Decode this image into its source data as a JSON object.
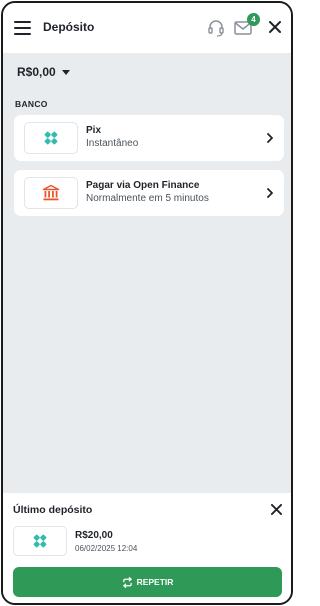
{
  "header": {
    "title": "Depósito",
    "mail_badge": "4"
  },
  "balance": {
    "amount": "R$0,00"
  },
  "section_label": "BANCO",
  "methods": [
    {
      "title": "Pix",
      "subtitle": "Instantâneo",
      "icon": "pix-icon"
    },
    {
      "title": "Pagar via Open Finance",
      "subtitle": "Normalmente em 5 minutos",
      "icon": "bank-icon"
    }
  ],
  "last_deposit": {
    "title": "Último depósito",
    "amount": "R$20,00",
    "date": "06/02/2025 12:04",
    "icon": "pix-icon",
    "repeat_label": "REPETIR"
  },
  "colors": {
    "accent_green": "#2f9a57",
    "pix_teal": "#32bcad",
    "bank_orange": "#e8562a",
    "background": "#e9ecef"
  }
}
